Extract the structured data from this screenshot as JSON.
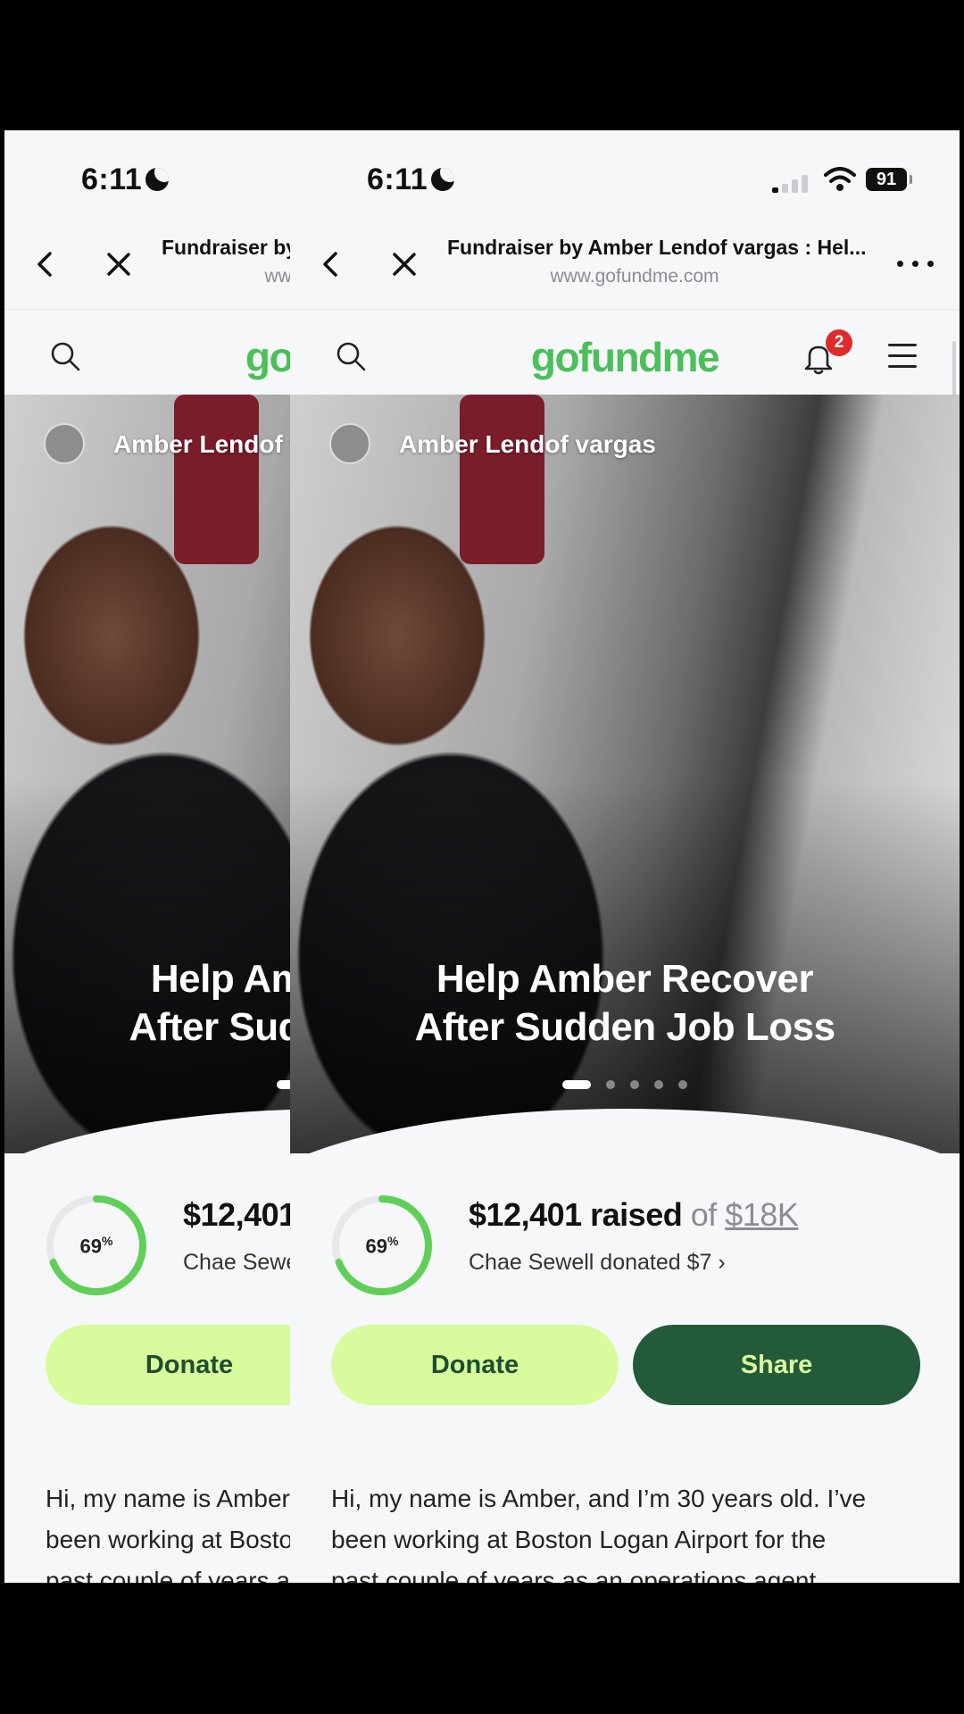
{
  "status_bar": {
    "time": "6:11",
    "battery": "91"
  },
  "browser": {
    "title": "Fundraiser by Amber Lendof vargas : Hel...",
    "url": "www.gofundme.com"
  },
  "site": {
    "logo": "gofundme",
    "notification_count": "2"
  },
  "campaign": {
    "author": "Amber Lendof vargas",
    "title_line1": "Help Amber Recover",
    "title_line2": "After Sudden Job Loss",
    "slide_count": 5,
    "active_slide": 1,
    "progress_percent": "69",
    "progress_fraction": 0.69,
    "raised_amount": "$12,401 raised",
    "raised_of": "of",
    "goal": "$18K",
    "recent_donation": "Chae Sewell donated $7",
    "donate_label": "Donate",
    "share_label": "Share",
    "story_line1": "Hi, my name is Amber, and I’m 30 years old. I’ve",
    "story_line2": "been working at Boston Logan Airport for the",
    "story_line3": "past couple of years as an operations agent"
  },
  "colors": {
    "brand_green": "#4bbf5a",
    "donate_bg": "#d8fb9d",
    "share_bg": "#235a39",
    "badge_red": "#e02b2b"
  },
  "icons": [
    "back-chevron-icon",
    "close-icon",
    "more-icon",
    "search-icon",
    "bell-icon",
    "menu-icon",
    "moon-icon",
    "signal-icon",
    "wifi-icon",
    "battery-icon",
    "chevron-right-icon"
  ]
}
